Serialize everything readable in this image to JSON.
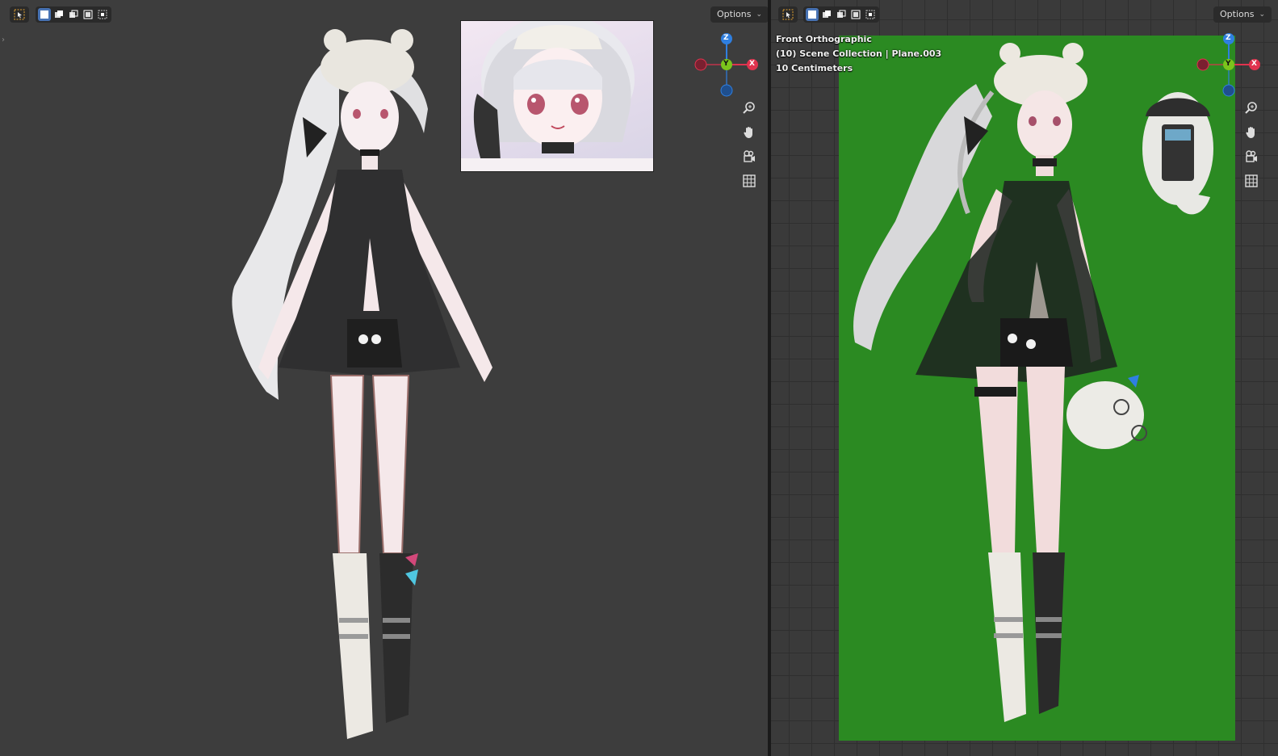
{
  "left_viewport": {
    "header": {
      "options_label": "Options"
    },
    "gizmo": {
      "z_label": "Z",
      "y_label": "Y",
      "x_label": "X"
    }
  },
  "right_viewport": {
    "header": {
      "options_label": "Options"
    },
    "overlay": {
      "view_name": "Front Orthographic",
      "collection": "(10) Scene Collection | Plane.003",
      "scale": "10 Centimeters"
    },
    "gizmo": {
      "z_label": "Z",
      "y_label": "Y",
      "x_label": "X"
    }
  },
  "colors": {
    "axis_x": "#e0334e",
    "axis_y": "#7bc41c",
    "axis_z": "#2f7fe0",
    "selection_active": "#4772b3",
    "plane_green": "#2b8a22"
  },
  "icons": {
    "select_tool": "select-box-icon",
    "nav": [
      "zoom-icon",
      "pan-hand-icon",
      "camera-icon",
      "grid-icon"
    ]
  }
}
